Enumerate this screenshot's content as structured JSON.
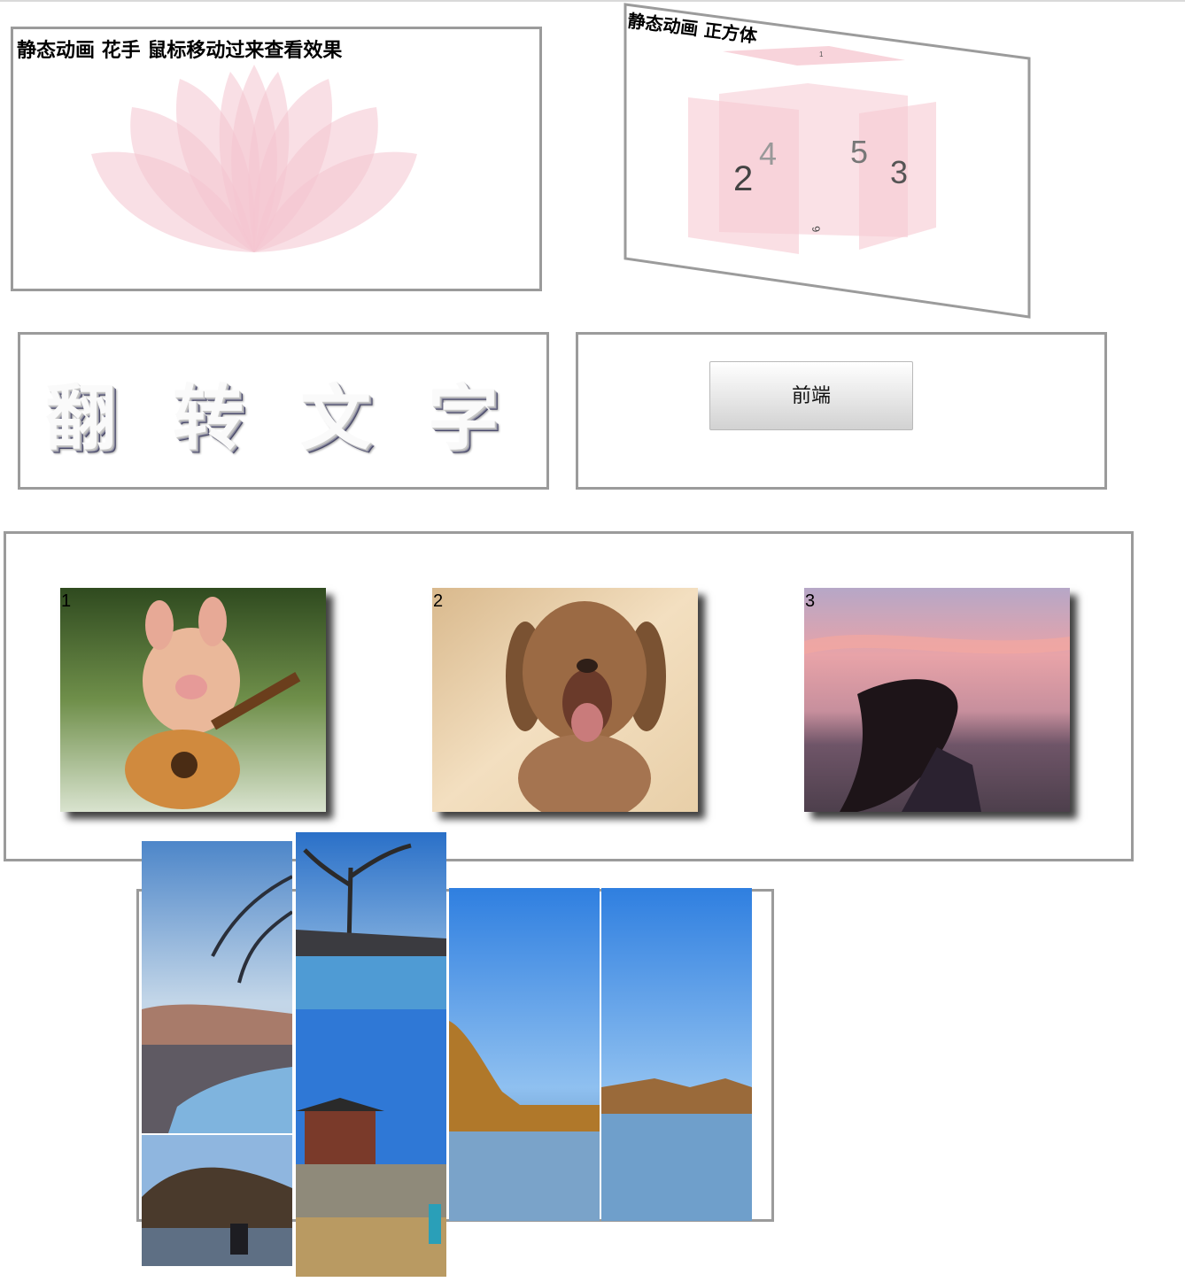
{
  "lotus": {
    "title": "静态动画 花手 鼠标移动过来查看效果"
  },
  "cube": {
    "title": "静态动画 正方体",
    "faces": [
      "1",
      "2",
      "3",
      "4",
      "5",
      "6"
    ]
  },
  "flip_text": {
    "chars": [
      "翻",
      "转",
      "文",
      "字"
    ]
  },
  "button": {
    "label": "前端"
  },
  "gallery": {
    "cards": [
      "1",
      "2",
      "3"
    ]
  },
  "colors": {
    "border": "#9b9b9b",
    "petal": "#f4c4cf",
    "cube_face": "#f6c9d2"
  }
}
